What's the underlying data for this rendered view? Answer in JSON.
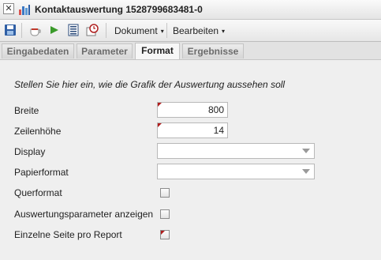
{
  "window": {
    "title": "Kontaktauswertung 1528799683481-0",
    "close_glyph": "✕"
  },
  "toolbar": {
    "icons": [
      "save-icon",
      "coffee-icon",
      "arrow-right-icon",
      "list-icon",
      "clock-icon"
    ],
    "menus": [
      {
        "label": "Dokument",
        "caret": "▾"
      },
      {
        "label": "Bearbeiten",
        "caret": "▾"
      }
    ]
  },
  "tabs": [
    {
      "label": "Eingabedaten",
      "active": false
    },
    {
      "label": "Parameter",
      "active": false
    },
    {
      "label": "Format",
      "active": true
    },
    {
      "label": "Ergebnisse",
      "active": false
    }
  ],
  "form": {
    "intro": "Stellen Sie hier ein, wie die Grafik der Auswertung aussehen soll",
    "breite": {
      "label": "Breite",
      "value": "800"
    },
    "zeilenhoehe": {
      "label": "Zeilenhöhe",
      "value": "14"
    },
    "display": {
      "label": "Display",
      "value": ""
    },
    "papierformat": {
      "label": "Papierformat",
      "value": ""
    },
    "querformat": {
      "label": "Querformat",
      "checked": false
    },
    "auswertungsparameter": {
      "label": "Auswertungsparameter anzeigen",
      "checked": false
    },
    "einzelne_seite": {
      "label": "Einzelne Seite pro Report",
      "checked": false
    }
  },
  "colors": {
    "marker": "#b01c1c",
    "background": "#efefef"
  }
}
